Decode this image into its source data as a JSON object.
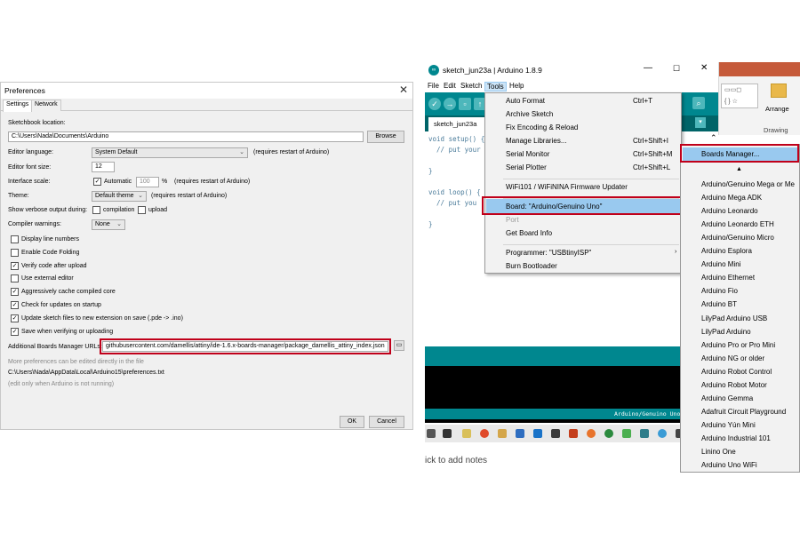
{
  "preferences": {
    "title": "Preferences",
    "tabs": [
      "Settings",
      "Network"
    ],
    "sketchbook_label": "Sketchbook location:",
    "sketchbook_value": "C:\\Users\\Nada\\Documents\\Arduino",
    "browse_label": "Browse",
    "editor_language_label": "Editor language:",
    "editor_language_value": "System Default",
    "restart_note": "(requires restart of Arduino)",
    "font_size_label": "Editor font size:",
    "font_size_value": "12",
    "interface_scale_label": "Interface scale:",
    "automatic_label": "Automatic",
    "scale_value": "100",
    "percent_label": "%",
    "theme_label": "Theme:",
    "theme_value": "Default theme",
    "verbose_label": "Show verbose output during:",
    "compilation_label": "compilation",
    "upload_label": "upload",
    "compiler_warnings_label": "Compiler warnings:",
    "compiler_warnings_value": "None",
    "checkboxes": [
      {
        "label": "Display line numbers",
        "checked": false
      },
      {
        "label": "Enable Code Folding",
        "checked": false
      },
      {
        "label": "Verify code after upload",
        "checked": true
      },
      {
        "label": "Use external editor",
        "checked": false
      },
      {
        "label": "Aggressively cache compiled core",
        "checked": true
      },
      {
        "label": "Check for updates on startup",
        "checked": true
      },
      {
        "label": "Update sketch files to new extension on save (.pde -> .ino)",
        "checked": true
      },
      {
        "label": "Save when verifying or uploading",
        "checked": true
      }
    ],
    "boards_url_label": "Additional Boards Manager URLs:",
    "boards_url_value": "githubusercontent.com/damellis/attiny/ide-1.6.x-boards-manager/package_damellis_attiny_index.json",
    "more_prefs_note": "More preferences can be edited directly in the file",
    "prefs_path": "C:\\Users\\Nada\\AppData\\Local\\Arduino15\\preferences.txt",
    "edit_note": "(edit only when Arduino is not running)",
    "ok_label": "OK",
    "cancel_label": "Cancel"
  },
  "ide": {
    "window_title": "sketch_jun23a | Arduino 1.8.9",
    "menu": [
      "File",
      "Edit",
      "Sketch",
      "Tools",
      "Help"
    ],
    "tab_name": "sketch_jun23a",
    "code_lines": [
      "void setup() {",
      "  // put your",
      "",
      "}",
      "",
      "void loop() {",
      "  // put you",
      "",
      "}"
    ],
    "status_board": "Arduino/Genuino Uno",
    "notes_text": "ick to add notes",
    "ribbon_arrange": "Arrange",
    "ribbon_drawing": "Drawing"
  },
  "tools_menu": {
    "items": [
      {
        "label": "Auto Format",
        "shortcut": "Ctrl+T"
      },
      {
        "label": "Archive Sketch",
        "shortcut": ""
      },
      {
        "label": "Fix Encoding & Reload",
        "shortcut": ""
      },
      {
        "label": "Manage Libraries...",
        "shortcut": "Ctrl+Shift+I"
      },
      {
        "label": "Serial Monitor",
        "shortcut": "Ctrl+Shift+M"
      },
      {
        "label": "Serial Plotter",
        "shortcut": "Ctrl+Shift+L"
      },
      {
        "label": "WiFi101 / WiFiNINA Firmware Updater",
        "shortcut": ""
      },
      {
        "label": "Board: \"Arduino/Genuino Uno\"",
        "shortcut": ""
      },
      {
        "label": "Port",
        "shortcut": ""
      },
      {
        "label": "Get Board Info",
        "shortcut": ""
      },
      {
        "label": "Programmer: \"USBtinyISP\"",
        "shortcut": ""
      },
      {
        "label": "Burn Bootloader",
        "shortcut": ""
      }
    ]
  },
  "boards_menu": {
    "manager_label": "Boards Manager...",
    "up_arrow": "▲",
    "boards": [
      "Arduino/Genuino Mega or Me",
      "Arduino Mega ADK",
      "Arduino Leonardo",
      "Arduino Leonardo ETH",
      "Arduino/Genuino Micro",
      "Arduino Esplora",
      "Arduino Mini",
      "Arduino Ethernet",
      "Arduino Fio",
      "Arduino BT",
      "LilyPad Arduino USB",
      "LilyPad Arduino",
      "Arduino Pro or Pro Mini",
      "Arduino NG or older",
      "Arduino Robot Control",
      "Arduino Robot Motor",
      "Arduino Gemma",
      "Adafruit Circuit Playground",
      "Arduino Yún Mini",
      "Arduino Industrial 101",
      "Linino One",
      "Arduino Uno WiFi"
    ]
  },
  "colors": {
    "arduino_teal": "#00878f",
    "highlight": "#99c9ef",
    "red_outline": "#c0001a"
  }
}
